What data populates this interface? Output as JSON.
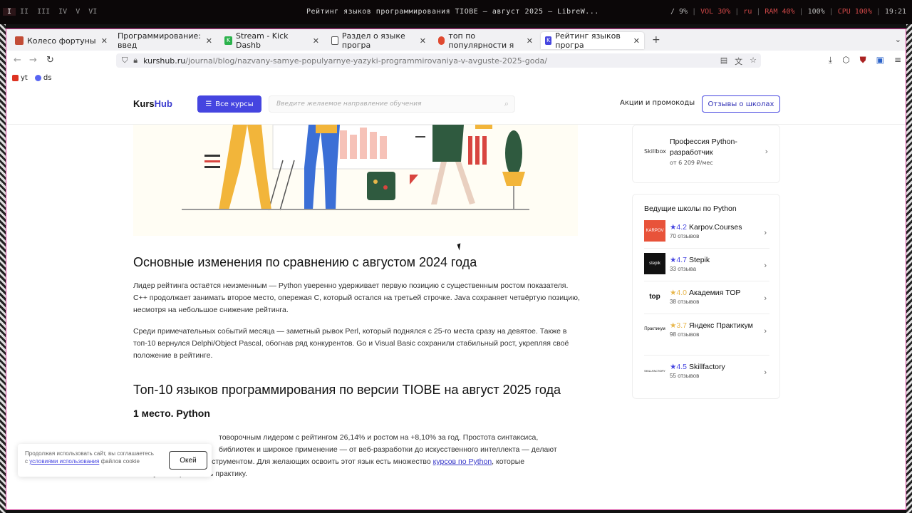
{
  "sysbar": {
    "workspaces": [
      "I",
      "II",
      "III",
      "IV",
      "V",
      "VI"
    ],
    "window_title": "Рейтинг языков программирования TIOBE — август 2025 — LibreW...",
    "stats": {
      "s1": "/ 9%",
      "s2": "VOL 30%",
      "s3": "ru",
      "s4": "RAM 40%",
      "s5": "100%",
      "s6": "CPU 100%",
      "s7": "19:21"
    }
  },
  "tabs": [
    {
      "label": "Колесо фортуны",
      "icon": "wheel-icon",
      "color": "#c24c36"
    },
    {
      "label": "Программирование: введ",
      "icon": "doc-icon",
      "color": "#444"
    },
    {
      "label": "Stream - Kick Dashb",
      "icon": "kick-icon",
      "color": "#2bb24c"
    },
    {
      "label": "Раздел о языке програ",
      "icon": "page-icon",
      "color": "#555"
    },
    {
      "label": "топ по популярности я",
      "icon": "yandex-icon",
      "color": "#e0492f"
    },
    {
      "label": "Рейтинг языков програ",
      "icon": "kurshub-icon",
      "color": "#4545e0"
    }
  ],
  "url": {
    "host": "kurshub.ru",
    "path": "/journal/blog/nazvany-samye-populyarnye-yazyki-programmirovaniya-v-avguste-2025-goda/"
  },
  "bookmarks": [
    {
      "label": "yt",
      "color": "#d32"
    },
    {
      "label": "ds",
      "color": "#5865f2"
    }
  ],
  "site": {
    "logo_left": "Kurs",
    "logo_right": "Hub",
    "courses_btn": "Все курсы",
    "search_placeholder": "Введите желаемое направление обучения",
    "promo": "Акции и промокоды",
    "reviews_btn": "Отзывы о школах"
  },
  "article": {
    "h_changes": "Основные изменения по сравнению с августом 2024 года",
    "p1": "Лидер рейтинга остаётся неизменным — Python уверенно удерживает первую позицию с существенным ростом показателя. C++ продолжает занимать второе место, опережая C, который остался на третьей строчке. Java сохраняет четвёртую позицию, несмотря на небольшое снижение рейтинга.",
    "p2": "Среди примечательных событий месяца — заметный рывок Perl, который поднялся с 25-го места сразу на девятое. Также в топ-10 вернулся Delphi/Object Pascal, обогнав ряд конкурентов. Go и Visual Basic сохранили стабильный рост, укрепляя своё положение в рейтинге.",
    "h_top10": "Топ-10 языков программирования по версии TIOBE на август 2025 года",
    "h_first": "1 место. Python",
    "p3_a": "товорочным лидером с рейтингом 26,14% и ростом на +8,10% за год. Простота синтаксиса,",
    "p3_b": "библиотек и широкое применение — от веб-разработки до искусственного интеллекта — делают",
    "p3_c": "его универсальным инструментом. Для желающих освоить этот язык есть множество",
    "p3_link": "курсов по Python",
    "p3_d": ", которые",
    "p3_e": "помогут быстро начать практику."
  },
  "sidebar": {
    "top_card": {
      "school": "Skillbox",
      "title": "Профессия Python-разработчик",
      "price": "от 6 209 ₽/мес"
    },
    "leaders_title": "Ведущие школы по Python",
    "schools": [
      {
        "rating": "4.2",
        "name": "Karpov.Courses",
        "reviews": "70 отзывов",
        "logo": "karpov courses",
        "logo_bg": "#e8533a",
        "star_color": "#4545e0"
      },
      {
        "rating": "4.7",
        "name": "Stepik",
        "reviews": "33 отзыва",
        "logo": "stepik",
        "logo_bg": "#111",
        "star_color": "#4545e0"
      },
      {
        "rating": "4.0",
        "name": "Академия ТОР",
        "reviews": "38 отзывов",
        "logo": "top",
        "logo_bg": "#fff",
        "star_color": "#e8b64a"
      },
      {
        "rating": "3.7",
        "name": "Яндекс Практикум",
        "reviews": "98 отзывов",
        "logo": "Практикум",
        "logo_bg": "#fff",
        "star_color": "#e8b64a"
      },
      {
        "rating": "4.5",
        "name": "Skillfactory",
        "reviews": "55 отзывов",
        "logo": "SKILLFACTORY",
        "logo_bg": "#fff",
        "star_color": "#4545e0"
      }
    ]
  },
  "cookie": {
    "text_a": "Продолжая использовать сайт, вы соглашаетесь с",
    "link": "условиями использования",
    "text_b": "файлов cookie",
    "ok": "Окей"
  }
}
